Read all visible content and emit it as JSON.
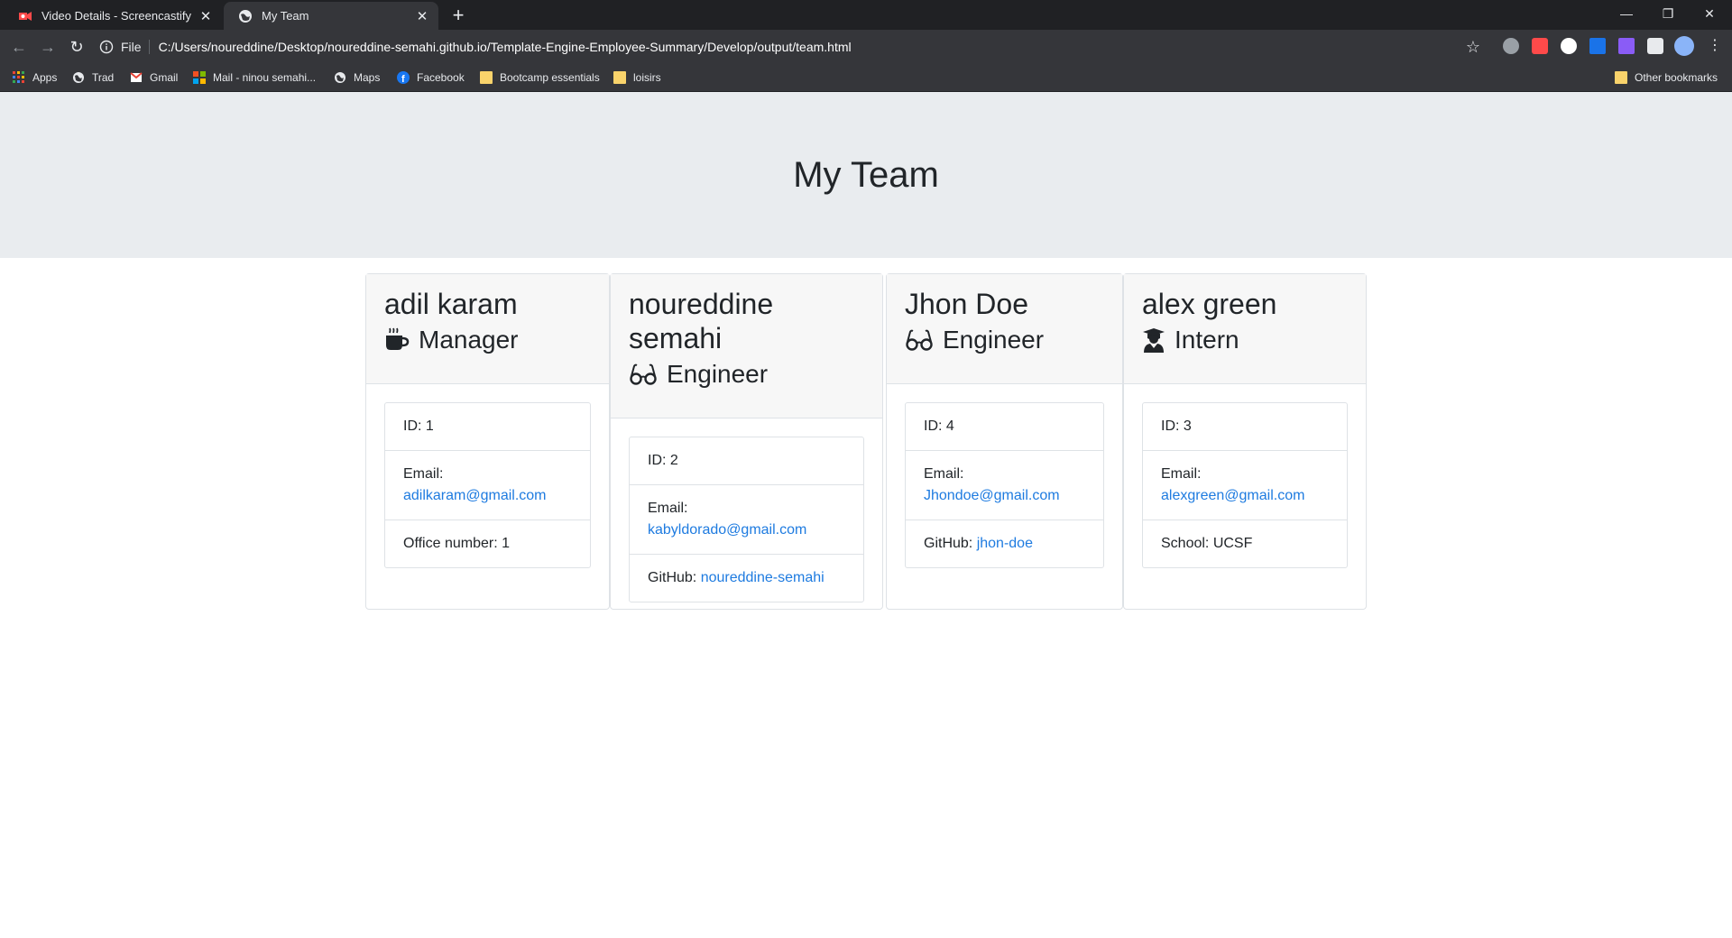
{
  "tabs": [
    {
      "title": "Video Details - Screencastify"
    },
    {
      "title": "My Team"
    }
  ],
  "address_bar": {
    "scheme_label": "File",
    "url": "C:/Users/noureddine/Desktop/noureddine-semahi.github.io/Template-Engine-Employee-Summary/Develop/output/team.html"
  },
  "bookmarks": [
    {
      "label": "Apps"
    },
    {
      "label": "Trad"
    },
    {
      "label": "Gmail"
    },
    {
      "label": "Mail - ninou semahi..."
    },
    {
      "label": "Maps"
    },
    {
      "label": "Facebook"
    },
    {
      "label": "Bootcamp essentials"
    },
    {
      "label": "loisirs"
    }
  ],
  "other_bookmarks": "Other bookmarks",
  "page": {
    "title": "My Team"
  },
  "team": [
    {
      "name": "adil karam",
      "role": "Manager",
      "icon": "mug-icon",
      "id_label": "ID: 1",
      "email_label": "Email:",
      "email": "adilkaram@gmail.com",
      "extra_label": "Office number: 1",
      "extra_link": ""
    },
    {
      "name": "noureddine semahi",
      "role": "Engineer",
      "icon": "glasses-icon",
      "id_label": "ID: 2",
      "email_label": "Email:",
      "email": "kabyldorado@gmail.com",
      "extra_label": "GitHub: ",
      "extra_link": "noureddine-semahi"
    },
    {
      "name": "Jhon Doe",
      "role": "Engineer",
      "icon": "glasses-icon",
      "id_label": "ID: 4",
      "email_label": "Email:",
      "email": "Jhondoe@gmail.com",
      "extra_label": "GitHub: ",
      "extra_link": "jhon-doe"
    },
    {
      "name": "alex green",
      "role": "Intern",
      "icon": "graduate-icon",
      "id_label": "ID: 3",
      "email_label": "Email:",
      "email": "alexgreen@gmail.com",
      "extra_label": "School: UCSF",
      "extra_link": ""
    }
  ],
  "colors": {
    "link": "#1e7be0",
    "jumbotron_bg": "#e9ecef",
    "chrome_dark": "#202124",
    "chrome_toolbar": "#35363a"
  }
}
